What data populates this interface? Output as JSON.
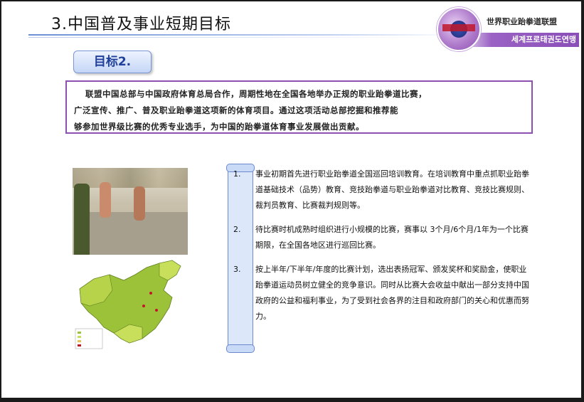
{
  "header": {
    "title": "3.中国普及事业短期目标",
    "org_name_cn": "世界职业跆拳道联盟",
    "org_name_kr": "세계프로태권도연맹"
  },
  "goal": {
    "label": "目标2."
  },
  "intro": {
    "line1": "联盟中国总部与中国政府体育总局合作，周期性地在全国各地举办正规的职业跆拳道比赛，",
    "line2": "广泛宣传、推广、普及职业跆拳道这项新的体育项目。通过这项活动总部挖掘和推荐能",
    "line3": "够参加世界级比赛的优秀专业选手，为中国的跆拳道体育事业发展做出贡献。"
  },
  "items": [
    {
      "num": "1.",
      "text": "事业初期首先进行职业跆拳道全国巡回培训教育。在培训教育中重点抓职业跆拳道基础技术（品势）教育、竞技跆拳道与职业跆拳道对比教育、竞技比赛规则、裁判员教育、比赛裁判规则等。"
    },
    {
      "num": "2.",
      "text": "待比赛时机成熟时组织进行小规模的比赛，赛事以 3个月/6个月/1年为一个比赛期限，在全国各地区进行巡回比赛。"
    },
    {
      "num": "3.",
      "text": "按上半年/下半年/年度的比赛计划，选出表扬冠军、颁发奖杯和奖励金，使职业跆拳道运动员树立健全的竞争意识。同时从比赛大会收益中献出一部分支持中国政府的公益和福利事业，为了受到社会各界的注目和政府部门的关心和优惠而努力。"
    }
  ],
  "colors": {
    "accent_purple": "#8d4fb0",
    "goal_blue": "#1f3f9a",
    "map_green": "#9cc23a"
  },
  "icons": {
    "logo": "federation-emblem-icon",
    "photo": "match-photo",
    "map": "china-map"
  }
}
